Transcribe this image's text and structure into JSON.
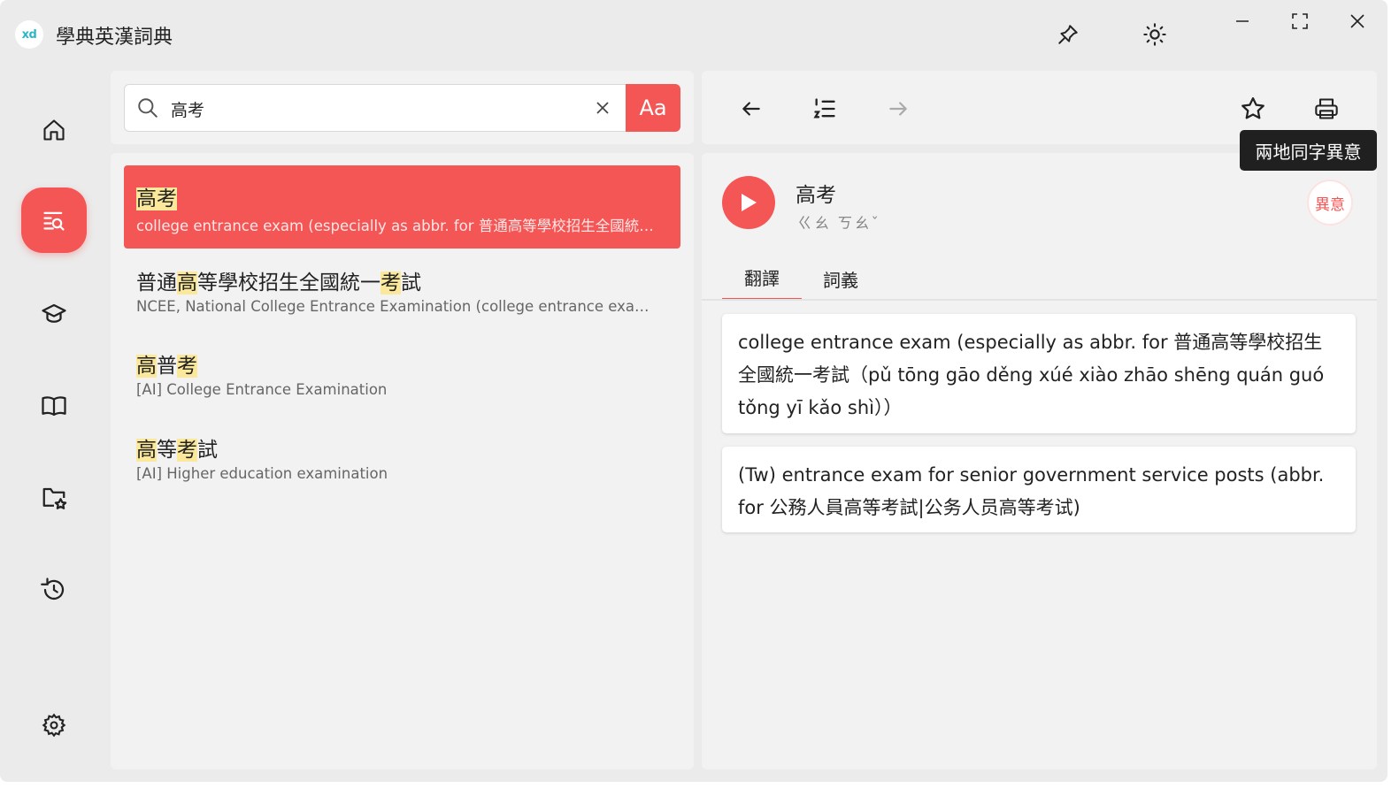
{
  "app": {
    "logo_text": "xd",
    "title": "學典英漢詞典"
  },
  "search": {
    "value": "高考",
    "placeholder": "",
    "case_button_label": "Aa"
  },
  "results": [
    {
      "headword": [
        {
          "t": "高考",
          "h": true
        }
      ],
      "gloss": "college entrance exam (especially as abbr. for 普通高等學校招生全國統一...",
      "active": true
    },
    {
      "headword": [
        {
          "t": "普通",
          "h": false
        },
        {
          "t": "高",
          "h": true
        },
        {
          "t": "等學校招生全國統一",
          "h": false
        },
        {
          "t": "考",
          "h": true
        },
        {
          "t": "試",
          "h": false
        }
      ],
      "gloss": "NCEE, National College Entrance Examination (college entrance exam in...",
      "active": false
    },
    {
      "headword": [
        {
          "t": "高",
          "h": true
        },
        {
          "t": "普",
          "h": false
        },
        {
          "t": "考",
          "h": true
        }
      ],
      "gloss": "[AI] College Entrance Examination",
      "active": false
    },
    {
      "headword": [
        {
          "t": "高",
          "h": true
        },
        {
          "t": "等",
          "h": false
        },
        {
          "t": "考",
          "h": true
        },
        {
          "t": "試",
          "h": false
        }
      ],
      "gloss": "[AI] Higher education examination",
      "active": false
    }
  ],
  "tooltip": {
    "text": "兩地同字異意"
  },
  "entry": {
    "word": "高考",
    "zhuyin": "ㄍㄠ ㄎㄠˇ",
    "badge": "異意",
    "tabs": [
      {
        "label": "翻譯",
        "active": true
      },
      {
        "label": "詞義",
        "active": false
      }
    ],
    "definitions": [
      "college entrance exam (especially as abbr. for 普通高等學校招生全國統一考試（pǔ tōng gāo děng xúé xiào zhāo shēng quán guó tǒng yī kǎo shì））",
      "(Tw) entrance exam for senior government service posts (abbr. for 公務人員高等考試|公务人员高等考试)"
    ]
  },
  "colors": {
    "accent": "#f45555",
    "highlight": "#fbe89a",
    "background": "#ebebeb",
    "panel": "#f2f2f2"
  },
  "icons": {
    "titlebar": [
      "pin-icon",
      "brightness-icon",
      "minimize-icon",
      "maximize-icon",
      "close-icon"
    ],
    "nav": [
      "home-icon",
      "search-list-icon",
      "graduation-cap-icon",
      "book-icon",
      "starred-folder-icon",
      "history-icon",
      "settings-icon"
    ],
    "toolbar": [
      "back-arrow-icon",
      "numbered-list-icon",
      "forward-arrow-icon",
      "star-icon",
      "printer-icon"
    ]
  }
}
